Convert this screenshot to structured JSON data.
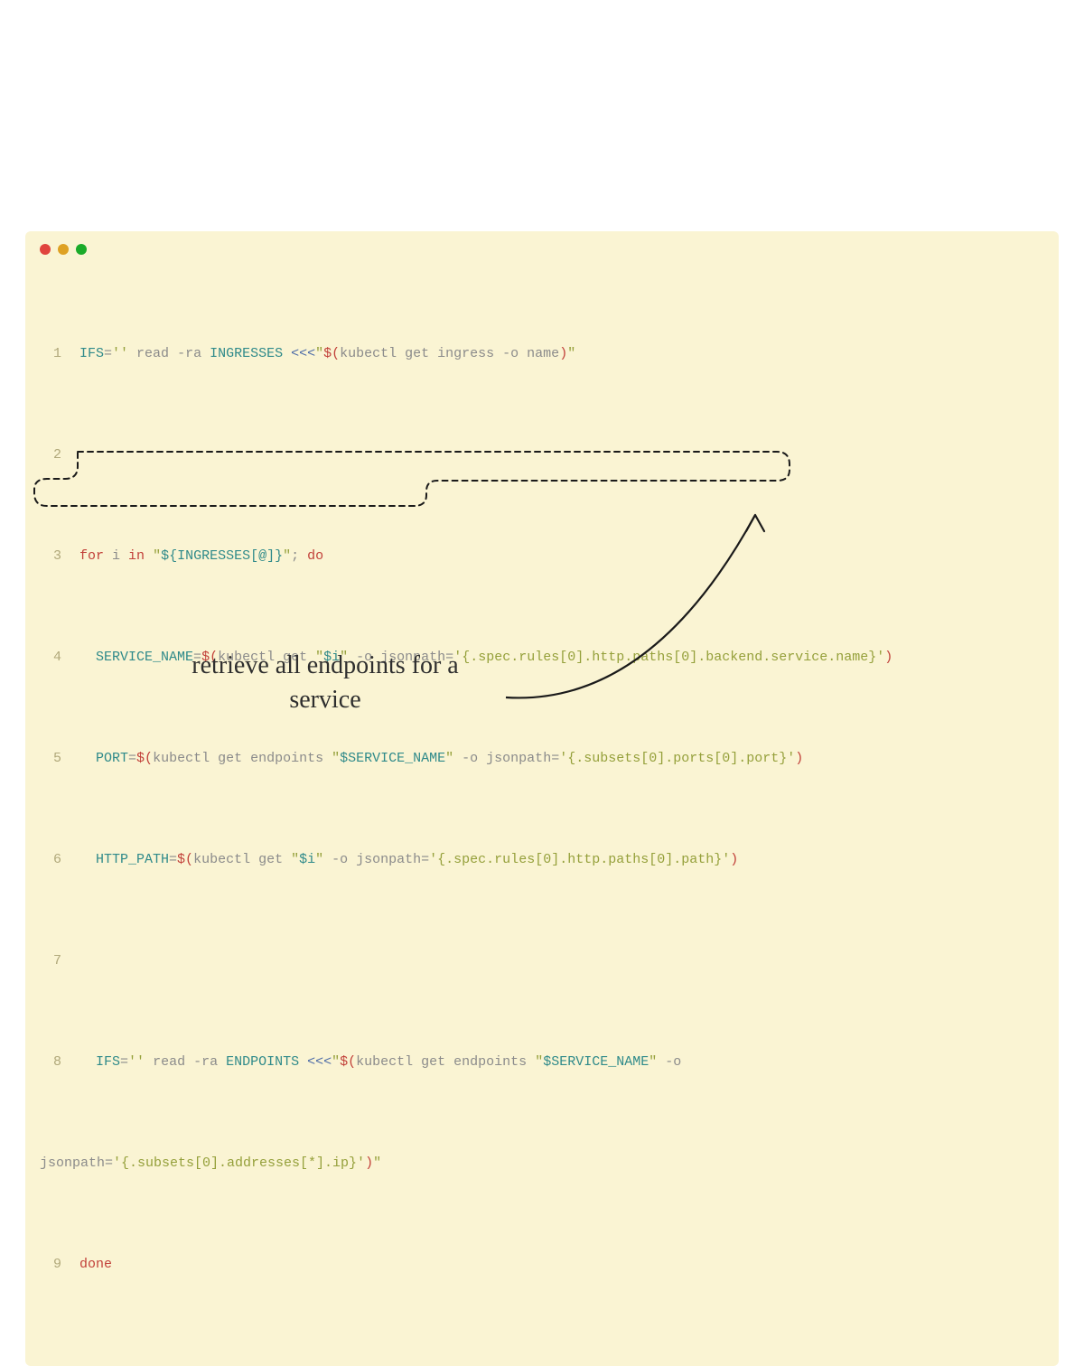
{
  "annotation": "retrieve all endpoints for a service",
  "code": {
    "line1": {
      "var": "IFS",
      "eq": "=",
      "str1": "''",
      "read": " read ",
      "flag": "-ra ",
      "var2": "INGRESSES ",
      "here": "<<<",
      "q1": "\"",
      "dollar": "$(",
      "cmd": "kubectl get ingress -o name",
      "close": ")",
      "q2": "\""
    },
    "line3": {
      "for": "for",
      "i": " i ",
      "in": "in",
      "sp": " ",
      "q1": "\"",
      "exp": "${INGRESSES[@]}",
      "q2": "\"",
      "semi": "; ",
      "do": "do"
    },
    "line4": {
      "indent": "  ",
      "var": "SERVICE_NAME",
      "eq": "=",
      "dollar": "$(",
      "cmd1": "kubectl get ",
      "q1": "\"",
      "ivar": "$i",
      "q2": "\"",
      "cmd2": " -o jsonpath=",
      "str": "'{.spec.rules[0].http.paths[0].backend.service.name}'",
      "close": ")"
    },
    "line5": {
      "indent": "  ",
      "var": "PORT",
      "eq": "=",
      "dollar": "$(",
      "cmd1": "kubectl get endpoints ",
      "q1": "\"",
      "svar": "$SERVICE_NAME",
      "q2": "\"",
      "cmd2": " -o jsonpath=",
      "str": "'{.subsets[0].ports[0].port}'",
      "close": ")"
    },
    "line6": {
      "indent": "  ",
      "var": "HTTP_PATH",
      "eq": "=",
      "dollar": "$(",
      "cmd1": "kubectl get ",
      "q1": "\"",
      "ivar": "$i",
      "q2": "\"",
      "cmd2": " -o jsonpath=",
      "str": "'{.spec.rules[0].http.paths[0].path}'",
      "close": ")"
    },
    "line8a": {
      "indent": "  ",
      "var": "IFS",
      "eq": "=",
      "str1": "''",
      "read": " read ",
      "flag": "-ra ",
      "var2": "ENDPOINTS ",
      "here": "<<<",
      "q1": "\"",
      "dollar": "$(",
      "cmd1": "kubectl get endpoints ",
      "q2": "\"",
      "svar": "$SERVICE_NAME",
      "q3": "\"",
      "cmd2": " -o "
    },
    "line8b": {
      "cmd": "jsonpath=",
      "str": "'{.subsets[0].addresses[*].ip}'",
      "close": ")",
      "q": "\""
    },
    "line9": {
      "done": "done"
    }
  }
}
